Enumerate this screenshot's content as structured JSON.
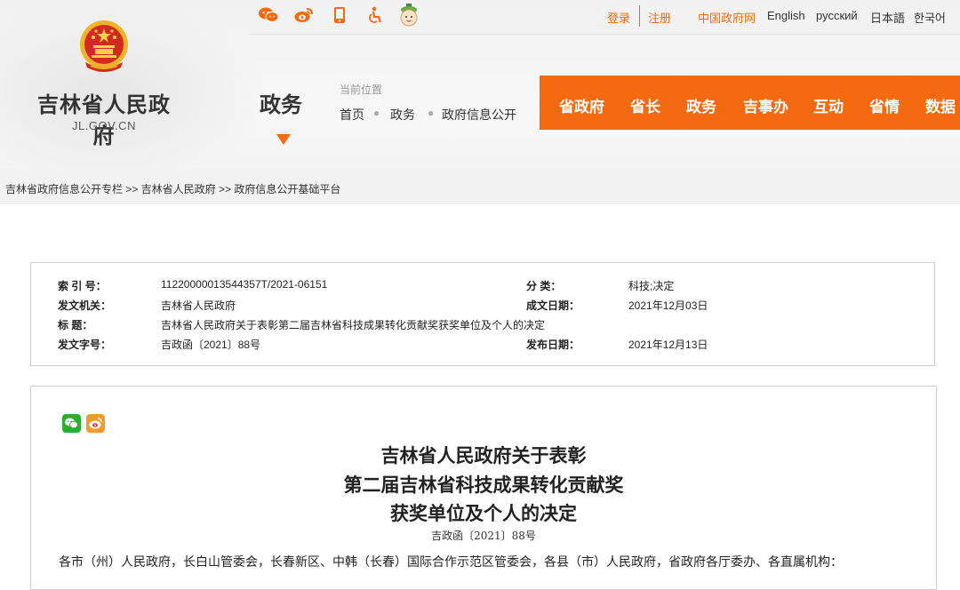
{
  "site": {
    "name": "吉林省人民政府",
    "domain": "JL.GOV.CN",
    "section": "政务"
  },
  "top_icons": [
    "weixin-icon",
    "weibo-icon",
    "mobile-icon",
    "accessibility-icon",
    "mascot-icon"
  ],
  "top_links": {
    "login": "登录",
    "register": "注册",
    "central": "中国政府网",
    "english": "English",
    "russian": "русский",
    "japanese": "日本語",
    "korean": "한국어"
  },
  "location": {
    "label": "当前位置",
    "items": [
      "首页",
      "政务",
      "政府信息公开"
    ]
  },
  "main_nav": [
    "省政府",
    "省长",
    "政务",
    "吉事办",
    "互动",
    "省情",
    "数据"
  ],
  "breadcrumb": "吉林省政府信息公开专栏 >> 吉林省人民政府 >> 政府信息公开基础平台",
  "meta": {
    "index_label": "索 引 号：",
    "index_value": "11220000013544357T/2021-06151",
    "category_label": "分 类：",
    "category_value": "科技;决定",
    "issuer_label": "发文机关：",
    "issuer_value": "吉林省人民政府",
    "date_label": "成文日期：",
    "date_value": "2021年12月03日",
    "title_label": "标 题：",
    "title_value": "吉林省人民政府关于表彰第二届吉林省科技成果转化贡献奖获奖单位及个人的决定",
    "docno_label": "发文字号：",
    "docno_value": "吉政函〔2021〕88号",
    "pubdate_label": "发布日期：",
    "pubdate_value": "2021年12月13日"
  },
  "article": {
    "title_line1": "吉林省人民政府关于表彰",
    "title_line2": "第二届吉林省科技成果转化贡献奖",
    "title_line3": "获奖单位及个人的决定",
    "doc_number": "吉政函〔2021〕88号",
    "body_first_line": "各市（州）人民政府，长白山管委会，长春新区、中韩（长春）国际合作示范区管委会，各县（市）人民政府，省政府各厅委办、各直属机构："
  },
  "colors": {
    "accent": "#f36a10",
    "nav_text": "#ffffff",
    "crumb_bg": "#f2f2f2"
  }
}
